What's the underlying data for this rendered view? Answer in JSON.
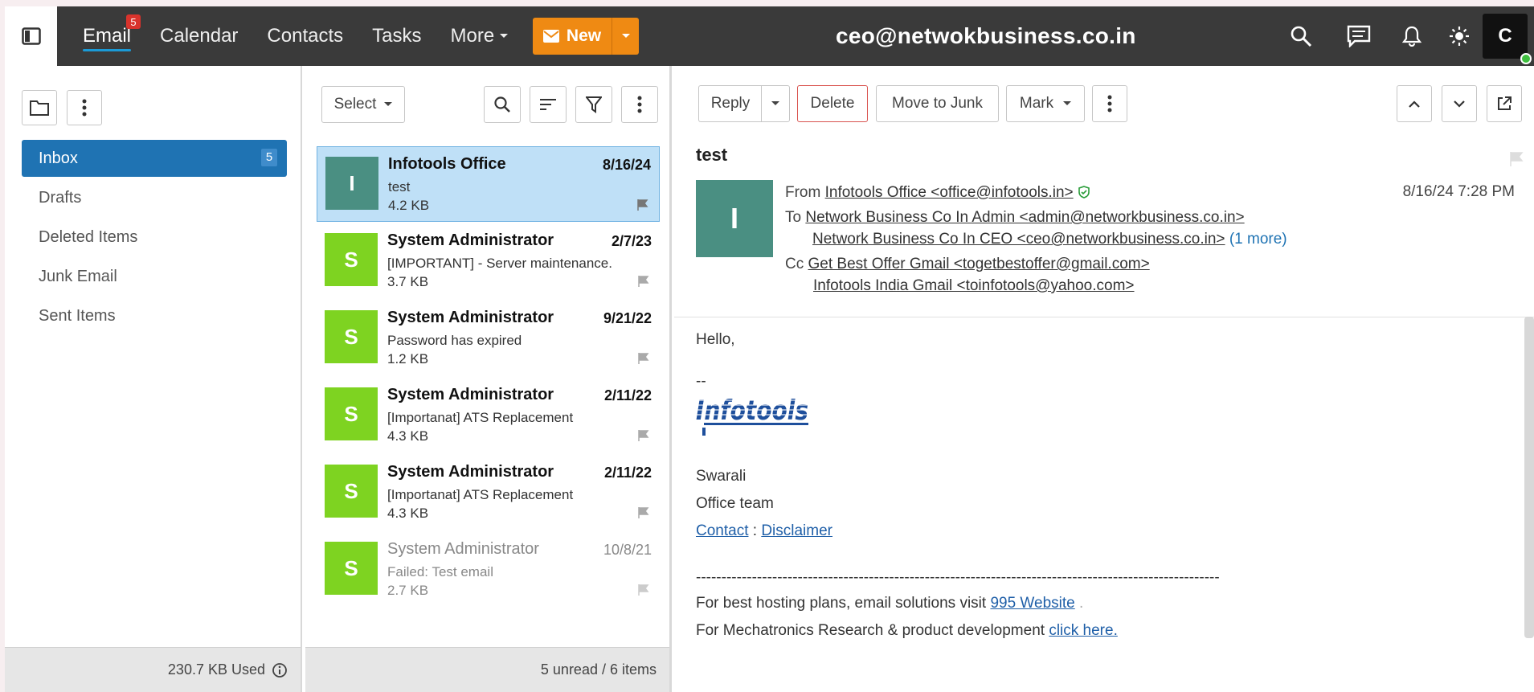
{
  "topbar": {
    "nav": [
      {
        "label": "Email",
        "badge": "5"
      },
      {
        "label": "Calendar"
      },
      {
        "label": "Contacts"
      },
      {
        "label": "Tasks"
      },
      {
        "label": "More"
      }
    ],
    "new_label": "New",
    "account": "ceo@netwokbusiness.co.in",
    "user_initial": "C",
    "accent_color": "#ef8a13"
  },
  "folders": {
    "items": [
      {
        "label": "Inbox",
        "count": "5"
      },
      {
        "label": "Drafts"
      },
      {
        "label": "Deleted Items"
      },
      {
        "label": "Junk Email"
      },
      {
        "label": "Sent Items"
      }
    ],
    "quota": "230.7 KB Used"
  },
  "list": {
    "select_label": "Select",
    "footer": "5 unread / 6 items",
    "messages": [
      {
        "initial": "I",
        "sender": "Infotools Office",
        "date": "8/16/24",
        "subject": "test",
        "size": "4.2 KB",
        "color": "#4a8f82"
      },
      {
        "initial": "S",
        "sender": "System Administrator",
        "date": "2/7/23",
        "subject": "[IMPORTANT] - Server maintenance.",
        "size": "3.7 KB",
        "color": "#7ed321"
      },
      {
        "initial": "S",
        "sender": "System Administrator",
        "date": "9/21/22",
        "subject": "Password has expired",
        "size": "1.2 KB",
        "color": "#7ed321"
      },
      {
        "initial": "S",
        "sender": "System Administrator",
        "date": "2/11/22",
        "subject": "[Importanat] ATS Replacement",
        "size": "4.3 KB",
        "color": "#7ed321"
      },
      {
        "initial": "S",
        "sender": "System Administrator",
        "date": "2/11/22",
        "subject": "[Importanat] ATS Replacement",
        "size": "4.3 KB",
        "color": "#7ed321"
      },
      {
        "initial": "S",
        "sender": "System Administrator",
        "date": "10/8/21",
        "subject": "Failed: Test email",
        "size": "2.7 KB",
        "color": "#7ed321"
      }
    ]
  },
  "reader": {
    "toolbar": {
      "reply": "Reply",
      "delete": "Delete",
      "junk": "Move to Junk",
      "mark": "Mark"
    },
    "subject": "test",
    "initial": "I",
    "from_label": "From",
    "from": "Infotools Office <office@infotools.in>",
    "date": "8/16/24 7:28 PM",
    "to_label": "To",
    "to": [
      "Network Business Co In Admin <admin@networkbusiness.co.in>",
      "Network Business Co In CEO <ceo@networkbusiness.co.in>"
    ],
    "to_more": "(1 more)",
    "cc_label": "Cc",
    "cc": [
      "Get Best Offer Gmail <togetbestoffer@gmail.com>",
      "Infotools India Gmail <toinfotools@yahoo.com>"
    ],
    "body": {
      "greeting": "Hello,",
      "sig_sep": "--",
      "logo_text": "Infotools",
      "name": "Swarali",
      "team": "Office team",
      "contact": "Contact",
      "colon": ":",
      "disclaimer": "Disclaimer",
      "divider": "-------------------------------------------------------------------------------------------------------",
      "line1": "For best hosting plans, email solutions visit",
      "link1": "995 Website",
      "dot": ".",
      "line2": "For Mechatronics Research & product development",
      "link2": "click here."
    }
  }
}
